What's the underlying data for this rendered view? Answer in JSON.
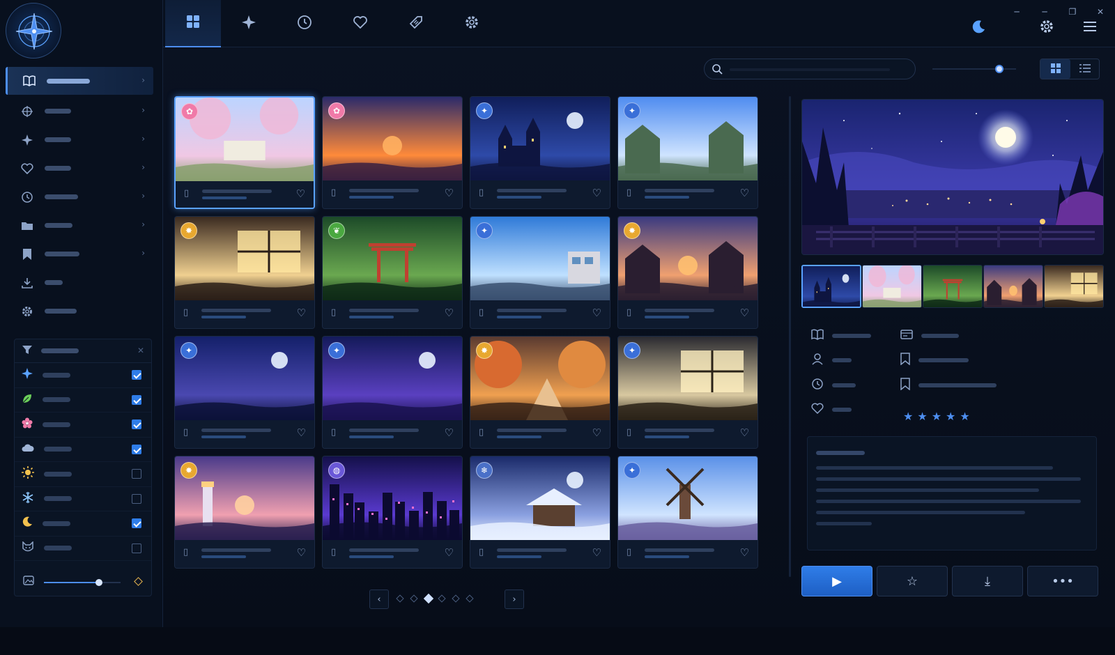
{
  "sidebar": {
    "nav_items": [
      {
        "label": "",
        "icon": "book-icon"
      },
      {
        "label": "",
        "icon": "target-icon"
      },
      {
        "label": "",
        "icon": "sparkle-icon"
      },
      {
        "label": "",
        "icon": "heart-icon"
      },
      {
        "label": "",
        "icon": "clock-icon"
      },
      {
        "label": "",
        "icon": "folder-icon"
      },
      {
        "label": "",
        "icon": "bookmark-icon"
      },
      {
        "label": "",
        "icon": "download-icon"
      },
      {
        "label": "",
        "icon": "gear-icon"
      }
    ],
    "filter": {
      "title": "",
      "rows": [
        {
          "label": "",
          "icon": "compass-star-icon",
          "checked": true,
          "color": "#5aa2ff"
        },
        {
          "label": "",
          "icon": "leaf-icon",
          "checked": true,
          "color": "#6ccf5a"
        },
        {
          "label": "",
          "icon": "flower-icon",
          "checked": true,
          "color": "#f07aa8"
        },
        {
          "label": "",
          "icon": "cloud-icon",
          "checked": true,
          "color": "#9fb4d6"
        },
        {
          "label": "",
          "icon": "sun-icon",
          "checked": false,
          "color": "#f2c14e"
        },
        {
          "label": "",
          "icon": "snowflake-icon",
          "checked": false,
          "color": "#8ec8ff"
        },
        {
          "label": "",
          "icon": "moon-icon",
          "checked": true,
          "color": "#f2c14e"
        },
        {
          "label": "",
          "icon": "cat-mask-icon",
          "checked": false,
          "color": "#8da3c7"
        }
      ],
      "slider_value": 0.72
    }
  },
  "topbar": {
    "tabs": [
      {
        "icon": "grid-icon",
        "active": true
      },
      {
        "icon": "sparkle-icon",
        "active": false
      },
      {
        "icon": "clock-icon",
        "active": false
      },
      {
        "icon": "heart-icon",
        "active": false
      },
      {
        "icon": "tag-icon",
        "active": false
      },
      {
        "icon": "gear-icon",
        "active": false
      }
    ],
    "right_icons": [
      "moon-icon",
      "gear-icon",
      "menu-icon"
    ],
    "window_controls": [
      "minimize-icon",
      "restore-icon",
      "close-icon"
    ]
  },
  "toolbar": {
    "search_value": "",
    "search_placeholder": "",
    "zoom_value": 0.8,
    "view_mode": "grid"
  },
  "grid": {
    "cards": [
      {
        "title": "",
        "subtitle": "",
        "badge": "flower",
        "scene": "sakura",
        "selected": true
      },
      {
        "title": "",
        "subtitle": "",
        "badge": "flower",
        "scene": "sunset",
        "selected": false
      },
      {
        "title": "",
        "subtitle": "",
        "badge": "compass",
        "scene": "castle-night",
        "selected": false
      },
      {
        "title": "",
        "subtitle": "",
        "badge": "compass",
        "scene": "town-day",
        "selected": false
      },
      {
        "title": "",
        "subtitle": "",
        "badge": "sun",
        "scene": "room-warm",
        "selected": false
      },
      {
        "title": "",
        "subtitle": "",
        "badge": "leaf",
        "scene": "forest-torii",
        "selected": false
      },
      {
        "title": "",
        "subtitle": "",
        "badge": "compass",
        "scene": "station-day",
        "selected": false
      },
      {
        "title": "",
        "subtitle": "",
        "badge": "sun",
        "scene": "street-dusk",
        "selected": false
      },
      {
        "title": "",
        "subtitle": "",
        "badge": "compass",
        "scene": "bridge-night",
        "selected": false
      },
      {
        "title": "",
        "subtitle": "",
        "badge": "compass",
        "scene": "field-night",
        "selected": false
      },
      {
        "title": "",
        "subtitle": "",
        "badge": "sun",
        "scene": "autumn-path",
        "selected": false
      },
      {
        "title": "",
        "subtitle": "",
        "badge": "compass",
        "scene": "classroom",
        "selected": false
      },
      {
        "title": "",
        "subtitle": "",
        "badge": "sun",
        "scene": "lighthouse",
        "selected": false
      },
      {
        "title": "",
        "subtitle": "",
        "badge": "globe",
        "scene": "city-night",
        "selected": false
      },
      {
        "title": "",
        "subtitle": "",
        "badge": "snowflake",
        "scene": "snow-temple",
        "selected": false
      },
      {
        "title": "",
        "subtitle": "",
        "badge": "compass",
        "scene": "windmill",
        "selected": false
      }
    ]
  },
  "pagination": {
    "pages": 6,
    "current": 3
  },
  "detail": {
    "meta_left": [
      {
        "icon": "book-icon",
        "label": ""
      },
      {
        "icon": "user-icon",
        "label": ""
      },
      {
        "icon": "clock-icon",
        "label": ""
      },
      {
        "icon": "heart-icon",
        "label": ""
      }
    ],
    "meta_right": [
      {
        "icon": "card-icon",
        "label": ""
      },
      {
        "icon": "bookmark-icon",
        "label": ""
      },
      {
        "icon": "bookmark-icon",
        "label": ""
      }
    ],
    "rating": 5,
    "stars": "★★★★★",
    "description_title": "",
    "description": "",
    "actions": [
      {
        "icon": "play-icon",
        "symbol": "▶",
        "primary": true
      },
      {
        "icon": "star-icon",
        "symbol": "☆",
        "primary": false
      },
      {
        "icon": "download-icon",
        "symbol": "⤓",
        "primary": false
      },
      {
        "icon": "more-icon",
        "symbol": "•••",
        "primary": false
      }
    ]
  },
  "colors": {
    "accent": "#4d8ef0",
    "background": "#070d19",
    "panel": "#0a1424"
  }
}
